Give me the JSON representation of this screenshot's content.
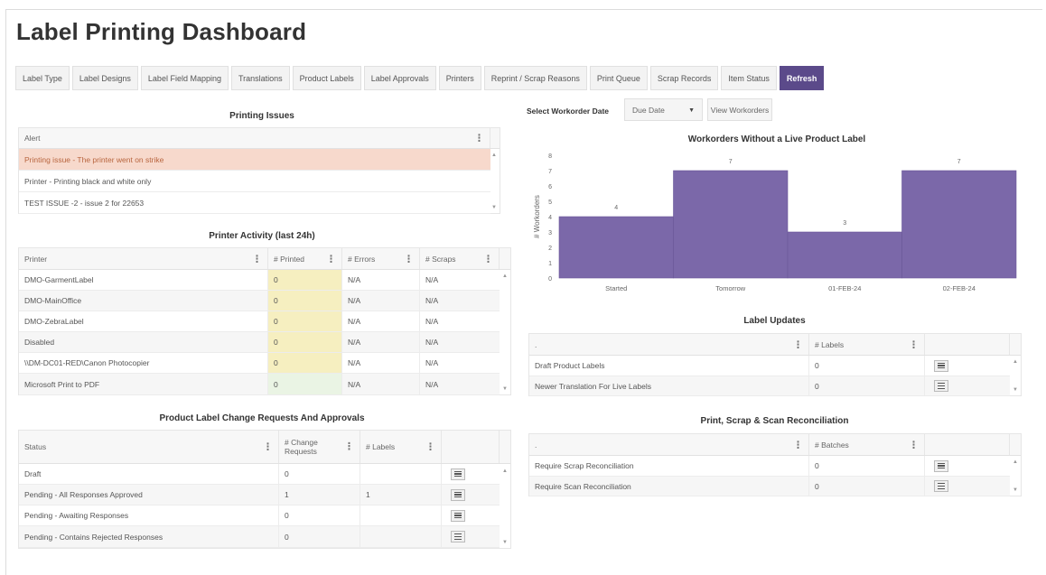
{
  "page": {
    "title": "Label Printing Dashboard"
  },
  "tabs": [
    {
      "label": "Label Type"
    },
    {
      "label": "Label Designs"
    },
    {
      "label": "Label Field Mapping"
    },
    {
      "label": "Translations"
    },
    {
      "label": "Product Labels"
    },
    {
      "label": "Label Approvals"
    },
    {
      "label": "Printers"
    },
    {
      "label": "Reprint / Scrap Reasons"
    },
    {
      "label": "Print Queue"
    },
    {
      "label": "Scrap Records"
    },
    {
      "label": "Item Status"
    },
    {
      "label": "Refresh",
      "active": true
    }
  ],
  "printing_issues": {
    "title": "Printing Issues",
    "header": "Alert",
    "rows": [
      "Printing issue - The printer went on strike",
      "Printer - Printing black and white only",
      "TEST ISSUE -2 - issue 2 for 22653"
    ]
  },
  "printer_activity": {
    "title": "Printer Activity (last 24h)",
    "headers": [
      "Printer",
      "# Printed",
      "# Errors",
      "# Scraps"
    ],
    "rows": [
      [
        "DMO-GarmentLabel",
        "0",
        "N/A",
        "N/A"
      ],
      [
        "DMO-MainOffice",
        "0",
        "N/A",
        "N/A"
      ],
      [
        "DMO-ZebraLabel",
        "0",
        "N/A",
        "N/A"
      ],
      [
        "Disabled",
        "0",
        "N/A",
        "N/A"
      ],
      [
        "\\\\DM-DC01-RED\\Canon Photocopier",
        "0",
        "N/A",
        "N/A"
      ],
      [
        "Microsoft Print to PDF",
        "0",
        "N/A",
        "N/A"
      ]
    ]
  },
  "change_requests": {
    "title": "Product Label Change Requests And Approvals",
    "headers": [
      "Status",
      "# Change Requests",
      "# Labels"
    ],
    "rows": [
      [
        "Draft",
        "0",
        ""
      ],
      [
        "Pending - All Responses Approved",
        "1",
        "1"
      ],
      [
        "Pending - Awaiting Responses",
        "0",
        ""
      ],
      [
        "Pending - Contains Rejected Responses",
        "0",
        ""
      ]
    ]
  },
  "workorder_filter": {
    "label": "Select Workorder Date",
    "selected": "Due Date",
    "button": "View Workorders"
  },
  "chart_data": {
    "type": "bar",
    "title": "Workorders Without a Live Product Label",
    "categories": [
      "Started",
      "Tomorrow",
      "01-FEB-24",
      "02-FEB-24"
    ],
    "values": [
      4,
      7,
      3,
      7
    ],
    "xlabel": "",
    "ylabel": "# Workorders",
    "ylim": [
      0,
      8
    ],
    "yticks": [
      0,
      1,
      2,
      3,
      4,
      5,
      6,
      7,
      8
    ],
    "color": "#7b68a9",
    "grid": false,
    "legend": "none"
  },
  "label_updates": {
    "title": "Label Updates",
    "headers": [
      ".",
      "# Labels"
    ],
    "rows": [
      [
        "Draft Product Labels",
        "0"
      ],
      [
        "Newer Translation For Live Labels",
        "0"
      ]
    ]
  },
  "reconciliation": {
    "title": "Print, Scrap & Scan Reconciliation",
    "headers": [
      ".",
      "# Batches"
    ],
    "rows": [
      [
        "Require Scrap Reconciliation",
        "0"
      ],
      [
        "Require Scan Reconciliation",
        "0"
      ]
    ]
  },
  "colors": {
    "accent": "#5b4a8a",
    "bar": "#7b68a9",
    "alert_bg": "#f7d9cc",
    "printed_bg": "#f6efc0"
  }
}
